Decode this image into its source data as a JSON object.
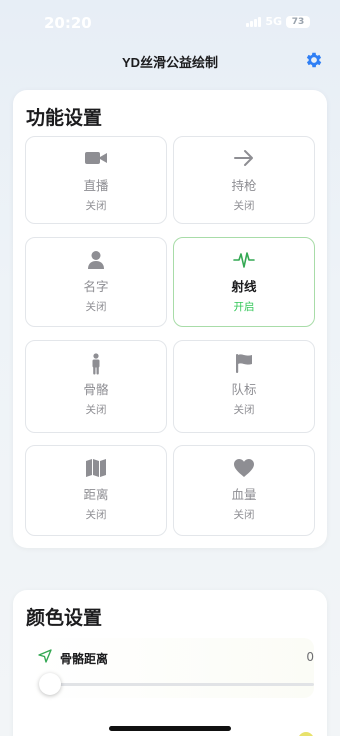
{
  "status_bar": {
    "time": "20:20",
    "network": "5G",
    "battery": "73"
  },
  "header": {
    "title": "YD丝滑公益绘制",
    "settings_icon": "gear-icon"
  },
  "colors": {
    "accent": "#2f7ff5",
    "active_border": "#a8dca8",
    "active_text": "#34c759",
    "muted": "#8e8e93"
  },
  "function_settings": {
    "title": "功能设置",
    "tiles": [
      {
        "label": "直播",
        "status": "关闭",
        "icon": "video-camera-icon",
        "active": false
      },
      {
        "label": "持枪",
        "status": "关闭",
        "icon": "arrow-right-icon",
        "active": false
      },
      {
        "label": "名字",
        "status": "关闭",
        "icon": "person-icon",
        "active": false
      },
      {
        "label": "射线",
        "status": "开启",
        "icon": "pulse-icon",
        "active": true
      },
      {
        "label": "骨骼",
        "status": "关闭",
        "icon": "standing-person-icon",
        "active": false
      },
      {
        "label": "队标",
        "status": "关闭",
        "icon": "flag-icon",
        "active": false
      },
      {
        "label": "距离",
        "status": "关闭",
        "icon": "map-icon",
        "active": false
      },
      {
        "label": "血量",
        "status": "关闭",
        "icon": "heart-icon",
        "active": false
      }
    ]
  },
  "color_settings": {
    "title": "颜色设置",
    "slider": {
      "label": "骨骼距离",
      "value": "0",
      "icon": "navigation-arrow-icon",
      "fraction": 0
    }
  }
}
